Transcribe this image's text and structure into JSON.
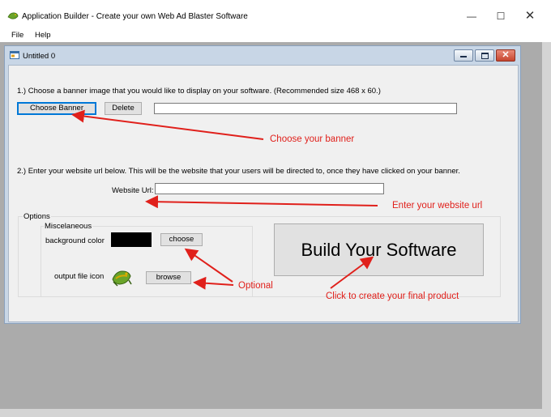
{
  "app": {
    "title": "Application Builder - Create your own Web Ad Blaster Software"
  },
  "menu": {
    "items": [
      "File",
      "Help"
    ]
  },
  "child_window": {
    "title": "Untitled 0"
  },
  "step1": {
    "instruction": "1.) Choose a banner image that you would like to display on your software. (Recommended size 468 x 60.)",
    "choose_banner_label": "Choose Banner",
    "delete_label": "Delete",
    "banner_path_value": ""
  },
  "step2": {
    "instruction": "2.) Enter your website url below. This will be the website that your users will be directed to, once they have clicked on your banner.",
    "website_url_label": "Website Url:",
    "website_url_value": ""
  },
  "options": {
    "legend": "Options",
    "misc_legend": "Miscelaneous",
    "background_color_label": "background color",
    "background_color_value": "#000000",
    "choose_label": "choose",
    "output_icon_label": "output file icon",
    "browse_label": "browse",
    "build_label": "Build Your Software"
  },
  "annotations": {
    "choose_banner": "Choose your banner",
    "enter_url": "Enter your website url",
    "optional": "Optional",
    "click_create": "Click to create your final product"
  },
  "colors": {
    "annotation": "#e0201b",
    "focus": "#0078d7"
  },
  "icons": {
    "app": "frog-icon",
    "minimize": "minimize-icon",
    "maximize": "maximize-icon",
    "close": "close-icon"
  }
}
